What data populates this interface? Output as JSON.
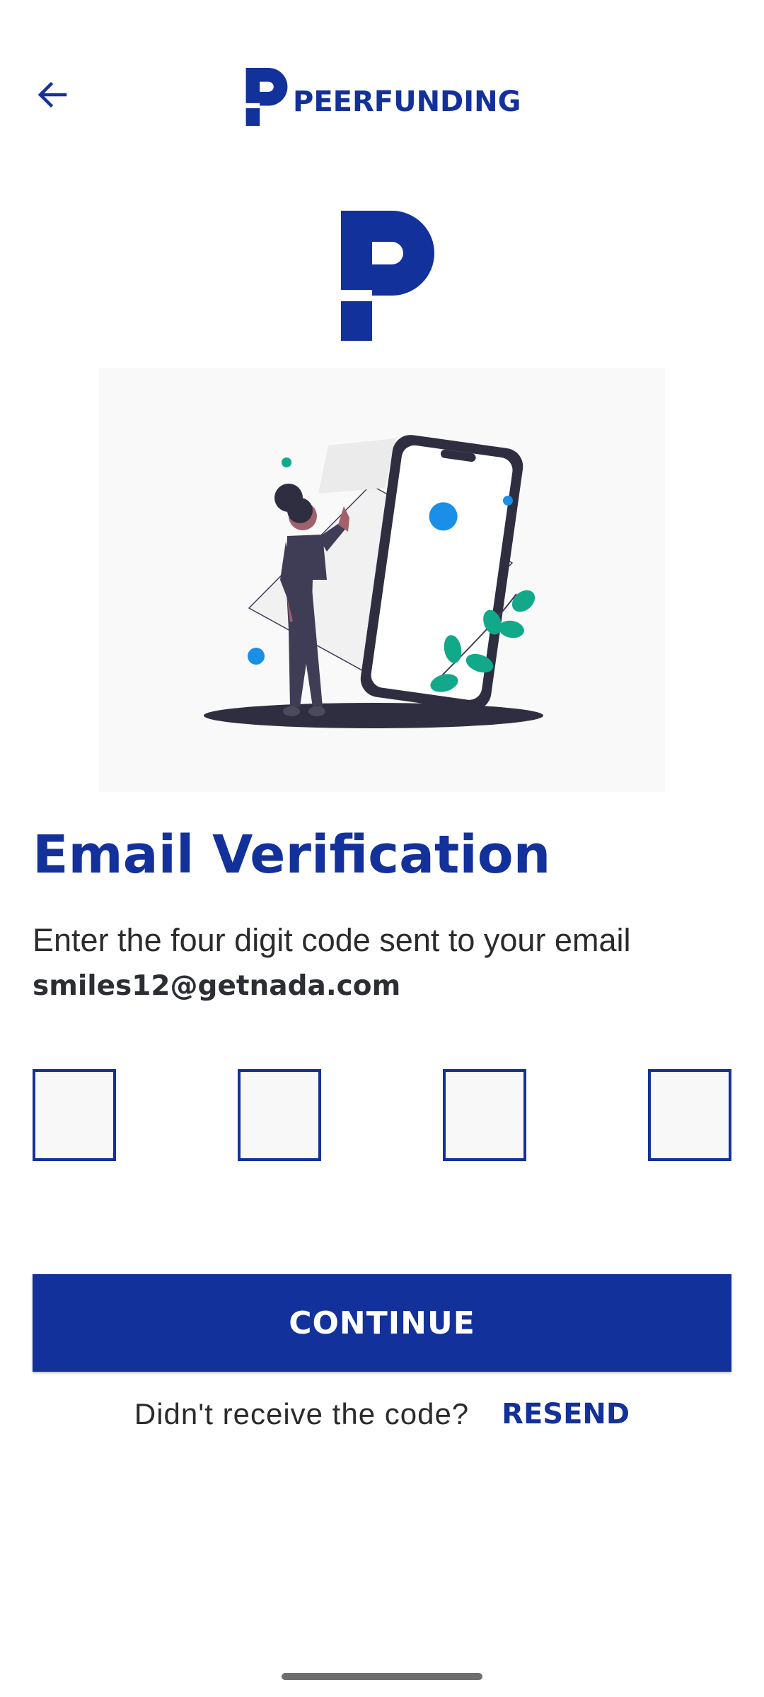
{
  "header": {
    "back_icon": "arrow-left-icon",
    "brand_name": "PEERFUNDING"
  },
  "main": {
    "title": "Email Verification",
    "instruction": "Enter the four digit code sent to your email",
    "email": "smiles12@getnada.com",
    "code_inputs": [
      "",
      "",
      "",
      ""
    ],
    "continue_label": "CONTINUE",
    "resend_question": "Didn't receive the code?",
    "resend_label": "RESEND"
  },
  "colors": {
    "brand": "#13319a",
    "illustration_accent": "#1a8fe8",
    "leaf": "#12a98a",
    "dark": "#2f2e41"
  }
}
